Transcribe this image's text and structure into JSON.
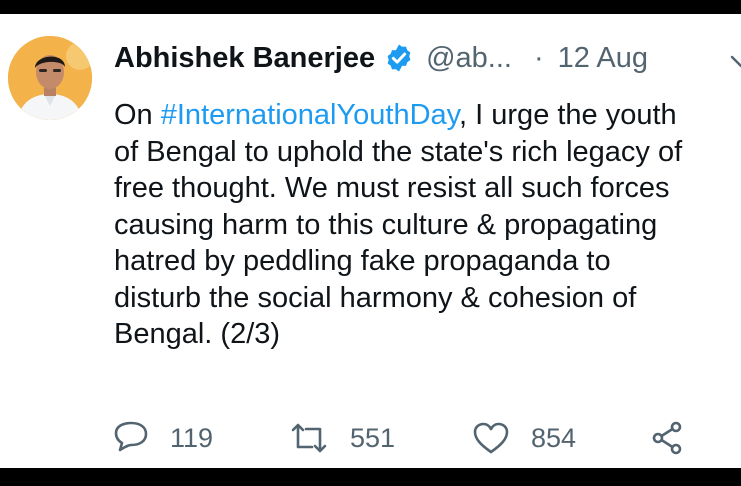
{
  "tweet": {
    "author_name": "Abhishek Banerjee",
    "handle": "@ab...",
    "separator": "·",
    "date": "12 Aug",
    "lines": [
      {
        "pre": "On ",
        "hashtag": "#InternationalYouthDay",
        "post": ", I urge the youth"
      },
      {
        "text": "of Bengal to uphold the state's rich legacy of"
      },
      {
        "text": "free thought. We must resist all such forces"
      },
      {
        "text": "causing harm to this culture & propagating"
      },
      {
        "text": "hatred by peddling fake propaganda to"
      },
      {
        "text": "disturb the social harmony & cohesion of"
      },
      {
        "text": "Bengal. (2/3)"
      }
    ]
  },
  "actions": {
    "reply_icon": "reply-icon",
    "reply_count": "119",
    "retweet_icon": "retweet-icon",
    "retweet_count": "551",
    "like_icon": "heart-icon",
    "like_count": "854",
    "share_icon": "share-icon"
  },
  "colors": {
    "text": "#0f1419",
    "muted": "#536471",
    "link": "#1d9bf0",
    "verified": "#1d9bf0",
    "frame": "#000000"
  }
}
